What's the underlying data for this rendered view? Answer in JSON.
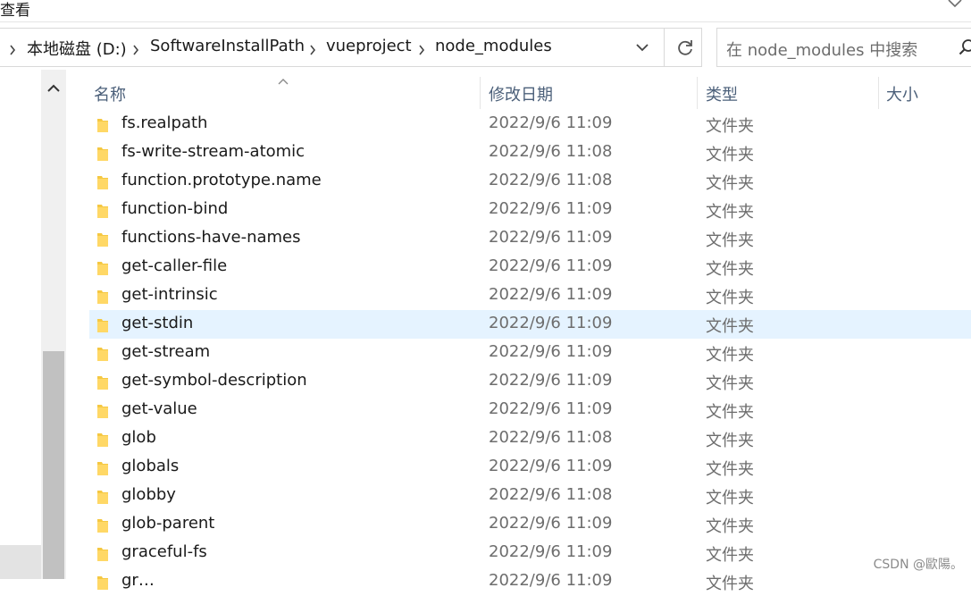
{
  "menu": {
    "view_label": "查看"
  },
  "breadcrumb": {
    "items": [
      "本地磁盘 (D:)",
      "SoftwareInstallPath",
      "vueproject",
      "node_modules"
    ]
  },
  "search": {
    "placeholder": "在 node_modules 中搜索"
  },
  "columns": {
    "name": "名称",
    "date": "修改日期",
    "type": "类型",
    "size": "大小"
  },
  "rows": [
    {
      "name": "fs.realpath",
      "date": "2022/9/6 11:09",
      "type": "文件夹"
    },
    {
      "name": "fs-write-stream-atomic",
      "date": "2022/9/6 11:08",
      "type": "文件夹"
    },
    {
      "name": "function.prototype.name",
      "date": "2022/9/6 11:08",
      "type": "文件夹"
    },
    {
      "name": "function-bind",
      "date": "2022/9/6 11:09",
      "type": "文件夹"
    },
    {
      "name": "functions-have-names",
      "date": "2022/9/6 11:09",
      "type": "文件夹"
    },
    {
      "name": "get-caller-file",
      "date": "2022/9/6 11:09",
      "type": "文件夹"
    },
    {
      "name": "get-intrinsic",
      "date": "2022/9/6 11:09",
      "type": "文件夹"
    },
    {
      "name": "get-stdin",
      "date": "2022/9/6 11:09",
      "type": "文件夹",
      "selected": true
    },
    {
      "name": "get-stream",
      "date": "2022/9/6 11:09",
      "type": "文件夹"
    },
    {
      "name": "get-symbol-description",
      "date": "2022/9/6 11:09",
      "type": "文件夹"
    },
    {
      "name": "get-value",
      "date": "2022/9/6 11:09",
      "type": "文件夹"
    },
    {
      "name": "glob",
      "date": "2022/9/6 11:08",
      "type": "文件夹"
    },
    {
      "name": "globals",
      "date": "2022/9/6 11:09",
      "type": "文件夹"
    },
    {
      "name": "globby",
      "date": "2022/9/6 11:08",
      "type": "文件夹"
    },
    {
      "name": "glob-parent",
      "date": "2022/9/6 11:09",
      "type": "文件夹"
    },
    {
      "name": "graceful-fs",
      "date": "2022/9/6 11:09",
      "type": "文件夹"
    },
    {
      "name": "gr…",
      "date": "2022/9/6 11:09",
      "type": "文件夹"
    }
  ],
  "watermark": "CSDN @歐陽。",
  "colors": {
    "selected_row": "#e5f3ff",
    "folder": "#f5c842",
    "header_text": "#4c607a"
  },
  "icons": [
    "chevron-down-icon",
    "chevron-right-icon",
    "refresh-icon",
    "search-icon",
    "folder-icon",
    "scroll-up-icon",
    "sort-ascending-icon"
  ]
}
